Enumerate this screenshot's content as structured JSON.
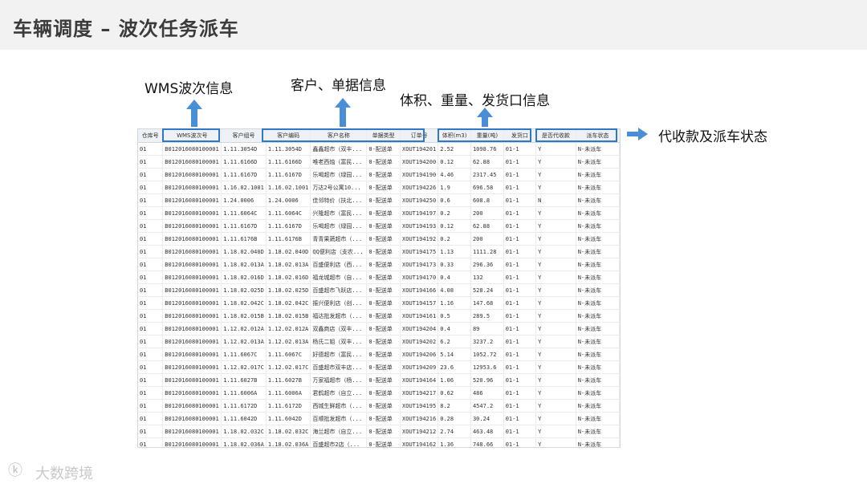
{
  "header": {
    "title": "车辆调度 – 波次任务派车"
  },
  "annotations": {
    "wms": "WMS波次信息",
    "customer": "客户、单据信息",
    "volume": "体积、重量、发货口信息",
    "status": "代收款及派车状态"
  },
  "table": {
    "columns": [
      "仓库号",
      "WMS波次号",
      "客户组号",
      "客户编码",
      "客户名称",
      "单据类型",
      "订单号",
      "体积(m3)",
      "重量(吨)",
      "发货口",
      "是否代收款",
      "派车状态"
    ],
    "rows": [
      [
        "01",
        "B012016080100001",
        "1.11.3054D",
        "1.11.3054D",
        "鑫鑫超市（双丰...",
        "0-配送单",
        "XOUT194201",
        "2.52",
        "1098.76",
        "01-1",
        "Y",
        "N-未派车"
      ],
      [
        "01",
        "B012016080100001",
        "1.11.6166D",
        "1.11.6166D",
        "唯老西烛（富民...",
        "0-配送单",
        "XOUT194200",
        "0.12",
        "62.88",
        "01-1",
        "Y",
        "N-未派车"
      ],
      [
        "01",
        "B012016080100001",
        "1.11.6167D",
        "1.11.6167D",
        "乐喝超市（绿园...",
        "0-配送单",
        "XOUT194190",
        "4.46",
        "2317.45",
        "01-1",
        "Y",
        "N-未派车"
      ],
      [
        "01",
        "B012016080100001",
        "1.16.02.1001",
        "1.16.02.1001",
        "万达2号公寓10...",
        "0-配送单",
        "XOUT194226",
        "1.9",
        "696.58",
        "01-1",
        "Y",
        "N-未派车"
      ],
      [
        "01",
        "B012016080100001",
        "1.24.0006",
        "1.24.0006",
        "佳邻特价（扶北...",
        "0-配送单",
        "XOUT194250",
        "0.6",
        "608.8",
        "01-1",
        "N",
        "N-未派车"
      ],
      [
        "01",
        "B012016080100001",
        "1.11.6064C",
        "1.11.6064C",
        "兴隆超市（富民...",
        "0-配送单",
        "XOUT194197",
        "0.2",
        "200",
        "01-1",
        "Y",
        "N-未派车"
      ],
      [
        "01",
        "B012016080100001",
        "1.11.6167D",
        "1.11.6167D",
        "乐喝超市（绿园...",
        "0-配送单",
        "XOUT194193",
        "0.12",
        "62.88",
        "01-1",
        "Y",
        "N-未派车"
      ],
      [
        "01",
        "B012016080100001",
        "1.11.6176B",
        "1.11.6176B",
        "青青果蔬超市（...",
        "0-配送单",
        "XOUT194192",
        "0.2",
        "200",
        "01-1",
        "Y",
        "N-未派车"
      ],
      [
        "01",
        "B012016080100001",
        "1.18.02.040D",
        "1.18.02.040D",
        "QQ便利店（支农...",
        "0-配送单",
        "XOUT194175",
        "1.13",
        "1111.28",
        "01-1",
        "Y",
        "N-未派车"
      ],
      [
        "01",
        "B012016080100001",
        "1.18.02.013A",
        "1.18.02.013A",
        "百盛便利店（西...",
        "0-配送单",
        "XOUT194173",
        "0.33",
        "296.36",
        "01-1",
        "Y",
        "N-未派车"
      ],
      [
        "01",
        "B012016080100001",
        "1.18.02.016D",
        "1.18.02.016D",
        "福龙城超市（自...",
        "0-配送单",
        "XOUT194170",
        "0.4",
        "132",
        "01-1",
        "Y",
        "N-未派车"
      ],
      [
        "01",
        "B012016080100001",
        "1.18.02.025D",
        "1.18.02.025D",
        "百盛超市飞跃店...",
        "0-配送单",
        "XOUT194166",
        "4.08",
        "528.24",
        "01-1",
        "Y",
        "N-未派车"
      ],
      [
        "01",
        "B012016080100001",
        "1.18.02.042C",
        "1.18.02.042C",
        "振兴便利店（创...",
        "0-配送单",
        "XOUT194157",
        "1.16",
        "147.68",
        "01-1",
        "Y",
        "N-未派车"
      ],
      [
        "01",
        "B012016080100001",
        "1.18.02.015B",
        "1.18.02.015B",
        "福达批发超市（...",
        "0-配送单",
        "XOUT194161",
        "0.5",
        "289.5",
        "01-1",
        "Y",
        "N-未派车"
      ],
      [
        "01",
        "B012016080100001",
        "1.12.02.012A",
        "1.12.02.012A",
        "双鑫商店（双丰...",
        "0-配送单",
        "XOUT194204",
        "0.4",
        "89",
        "01-1",
        "Y",
        "N-未派车"
      ],
      [
        "01",
        "B012016080100001",
        "1.12.02.013A",
        "1.12.02.013A",
        "杨氏二姐（双丰...",
        "0-配送单",
        "XOUT194202",
        "6.2",
        "3237.2",
        "01-1",
        "Y",
        "N-未派车"
      ],
      [
        "01",
        "B012016080100001",
        "1.11.6067C",
        "1.11.6067C",
        "好德超市（富民...",
        "0-配送单",
        "XOUT194206",
        "5.14",
        "1052.72",
        "01-1",
        "Y",
        "N-未派车"
      ],
      [
        "01",
        "B012016080100001",
        "1.12.02.017C",
        "1.12.02.017C",
        "百盛超市双丰店...",
        "0-配送单",
        "XOUT194209",
        "23.6",
        "12953.6",
        "01-1",
        "Y",
        "N-未派车"
      ],
      [
        "01",
        "B012016080100001",
        "1.11.6027B",
        "1.11.6027B",
        "万家福超市（杨...",
        "0-配送单",
        "XOUT194164",
        "1.06",
        "520.96",
        "01-1",
        "Y",
        "N-未派车"
      ],
      [
        "01",
        "B012016080100001",
        "1.11.6006A",
        "1.11.6006A",
        "君鹤超市（自立...",
        "0-配送单",
        "XOUT194217",
        "0.62",
        "486",
        "01-1",
        "Y",
        "N-未派车"
      ],
      [
        "01",
        "B012016080100001",
        "1.11.6172D",
        "1.11.6172D",
        "西城生鲜超市（...",
        "0-配送单",
        "XOUT194195",
        "8.2",
        "4547.2",
        "01-1",
        "Y",
        "N-未派车"
      ],
      [
        "01",
        "B012016080100001",
        "1.11.6042D",
        "1.11.6042D",
        "百顺批发超市（...",
        "0-配送单",
        "XOUT194216",
        "0.28",
        "30.24",
        "01-1",
        "Y",
        "N-未派车"
      ],
      [
        "01",
        "B012016080100001",
        "1.18.02.032C",
        "1.18.02.032C",
        "海兰超市（自立...",
        "0-配送单",
        "XOUT194212",
        "2.74",
        "463.48",
        "01-1",
        "Y",
        "N-未派车"
      ],
      [
        "01",
        "B012016080100001",
        "1.18.02.036A",
        "1.18.02.036A",
        "百盛超市2店（...",
        "0-配送单",
        "XOUT194162",
        "1.36",
        "748.66",
        "01-1",
        "Y",
        "N-未派车"
      ],
      [
        "01",
        "B012016080100001",
        "1.18.02.038A",
        "1.18.02.038A",
        "家源综合超市（...",
        "0-配送单",
        "XOUT194159",
        "9.28",
        "5272.96",
        "01-1",
        "Y",
        "N-未派车"
      ]
    ]
  },
  "logo": {
    "name": "大数跨境"
  }
}
